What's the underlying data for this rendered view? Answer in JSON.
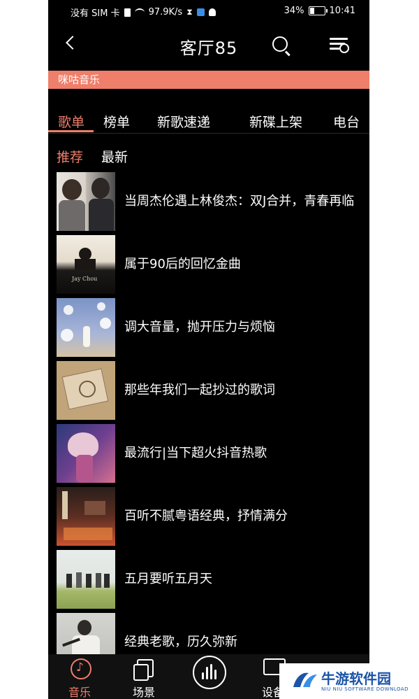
{
  "status_bar": {
    "carrier": "没有 SIM 卡",
    "speed": "97.9K/s",
    "battery": "34%",
    "time": "10:41"
  },
  "header": {
    "title": "客厅85",
    "icons": [
      "back-icon",
      "search-icon",
      "playlist-icon"
    ]
  },
  "banner": {
    "label": "咪咕音乐"
  },
  "tabs": [
    {
      "label": "歌单",
      "active": true
    },
    {
      "label": "榜单"
    },
    {
      "label": "新歌速递"
    },
    {
      "label": "新碟上架"
    },
    {
      "label": "电台"
    }
  ],
  "subtabs": [
    {
      "label": "推荐",
      "active": true
    },
    {
      "label": "最新"
    }
  ],
  "playlists": [
    {
      "title": "当周杰伦遇上林俊杰：双J合并，青春再临"
    },
    {
      "title": "属于90后的回忆金曲"
    },
    {
      "title": "调大音量，抛开压力与烦恼"
    },
    {
      "title": "那些年我们一起抄过的歌词"
    },
    {
      "title": "最流行|当下超火抖音热歌"
    },
    {
      "title": "百听不腻粤语经典，抒情满分"
    },
    {
      "title": "五月要听五月天"
    },
    {
      "title": "经典老歌，历久弥新"
    }
  ],
  "bottom_nav": [
    {
      "label": "音乐",
      "icon": "music-note-icon",
      "active": true
    },
    {
      "label": "场景",
      "icon": "scene-icon"
    },
    {
      "label": "",
      "icon": "voice-wave-icon"
    },
    {
      "label": "设备",
      "icon": "device-icon"
    }
  ],
  "watermark": {
    "title": "牛游软件园",
    "subtitle": "NIU NIU SOFTWARE DOWNLOAD"
  },
  "colors": {
    "accent": "#ef7e6a",
    "background": "#000000",
    "watermark_blue": "#1b54a8"
  }
}
